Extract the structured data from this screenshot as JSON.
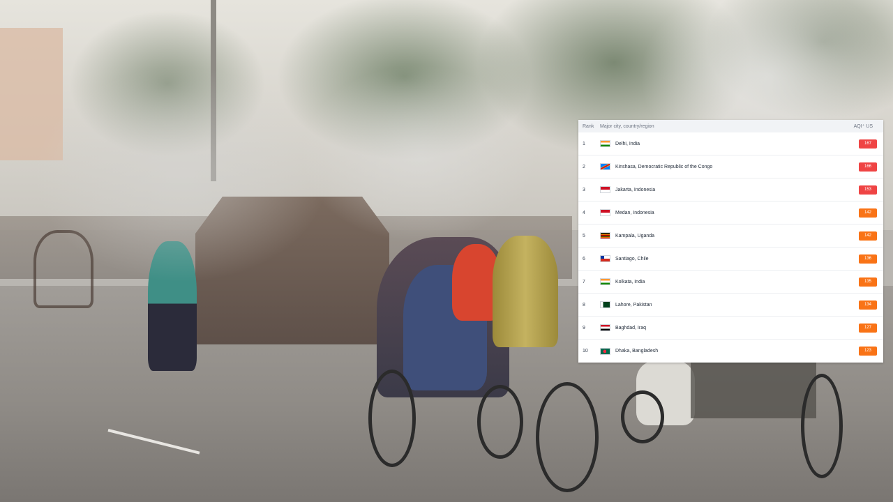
{
  "ranking_table": {
    "header": {
      "rank": "Rank",
      "city": "Major city, country/region",
      "aqi": "AQI⁺ US"
    },
    "rows": [
      {
        "rank": "1",
        "city": "Delhi, India",
        "flag": "india-flag-icon",
        "aqi": "167",
        "aqi_color": "#ef4444"
      },
      {
        "rank": "2",
        "city": "Kinshasa, Democratic Republic of the Congo",
        "flag": "drc-flag-icon",
        "aqi": "166",
        "aqi_color": "#ef4444"
      },
      {
        "rank": "3",
        "city": "Jakarta, Indonesia",
        "flag": "indonesia-flag-icon",
        "aqi": "153",
        "aqi_color": "#ef4444"
      },
      {
        "rank": "4",
        "city": "Medan, Indonesia",
        "flag": "indonesia-flag-icon",
        "aqi": "142",
        "aqi_color": "#f97316"
      },
      {
        "rank": "5",
        "city": "Kampala, Uganda",
        "flag": "uganda-flag-icon",
        "aqi": "142",
        "aqi_color": "#f97316"
      },
      {
        "rank": "6",
        "city": "Santiago, Chile",
        "flag": "chile-flag-icon",
        "aqi": "136",
        "aqi_color": "#f97316"
      },
      {
        "rank": "7",
        "city": "Kolkata, India",
        "flag": "india-flag-icon",
        "aqi": "135",
        "aqi_color": "#f97316"
      },
      {
        "rank": "8",
        "city": "Lahore, Pakistan",
        "flag": "pakistan-flag-icon",
        "aqi": "134",
        "aqi_color": "#f97316"
      },
      {
        "rank": "9",
        "city": "Baghdad, Iraq",
        "flag": "iraq-flag-icon",
        "aqi": "127",
        "aqi_color": "#f97316"
      },
      {
        "rank": "10",
        "city": "Dhaka, Bangladesh",
        "flag": "bangladesh-flag-icon",
        "aqi": "123",
        "aqi_color": "#f97316"
      }
    ]
  }
}
